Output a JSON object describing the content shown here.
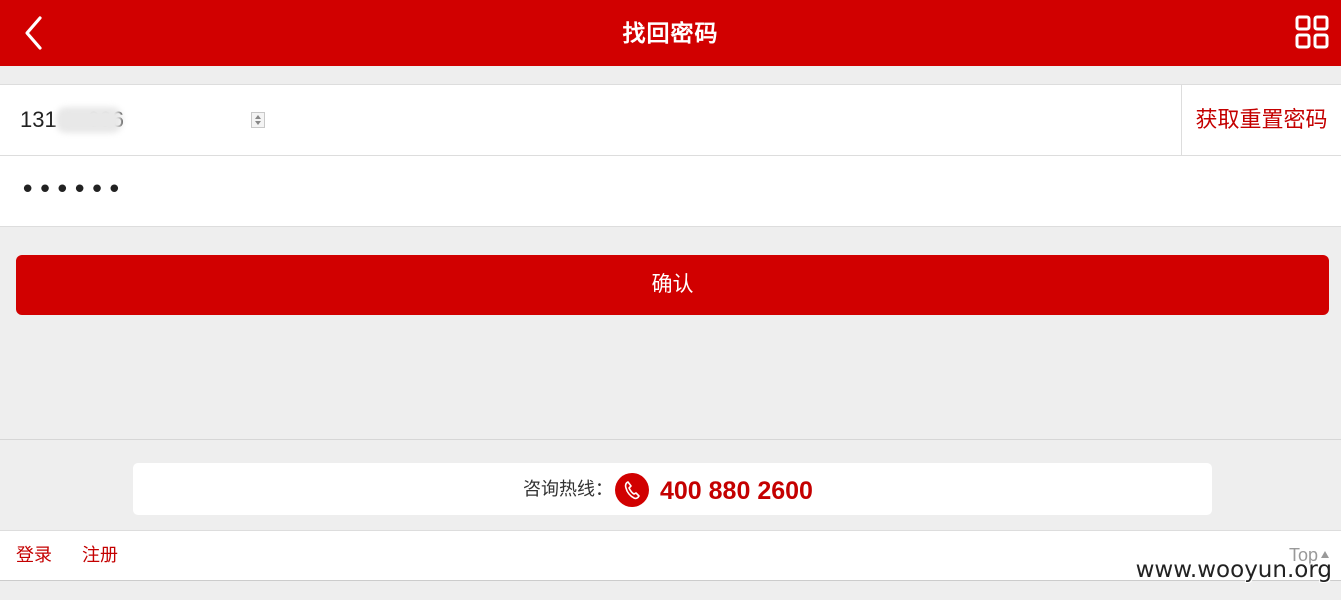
{
  "header": {
    "title": "找回密码",
    "back_icon": "chevron-left-icon",
    "menu_icon": "grid-icon",
    "bg_color": "#d10000"
  },
  "form": {
    "phone_value": "131     696",
    "get_code_label": "获取重置密码",
    "password_value": "••••••"
  },
  "confirm_label": "确认",
  "hotline": {
    "label": "咨询热线：",
    "number": "400 880 2600",
    "icon": "phone-icon"
  },
  "footer": {
    "login": "登录",
    "register": "注册",
    "top": "Top"
  },
  "watermark": "www.wooyun.org",
  "colors": {
    "accent": "#d10000",
    "link": "#c40000",
    "page_bg": "#eeeeee"
  }
}
